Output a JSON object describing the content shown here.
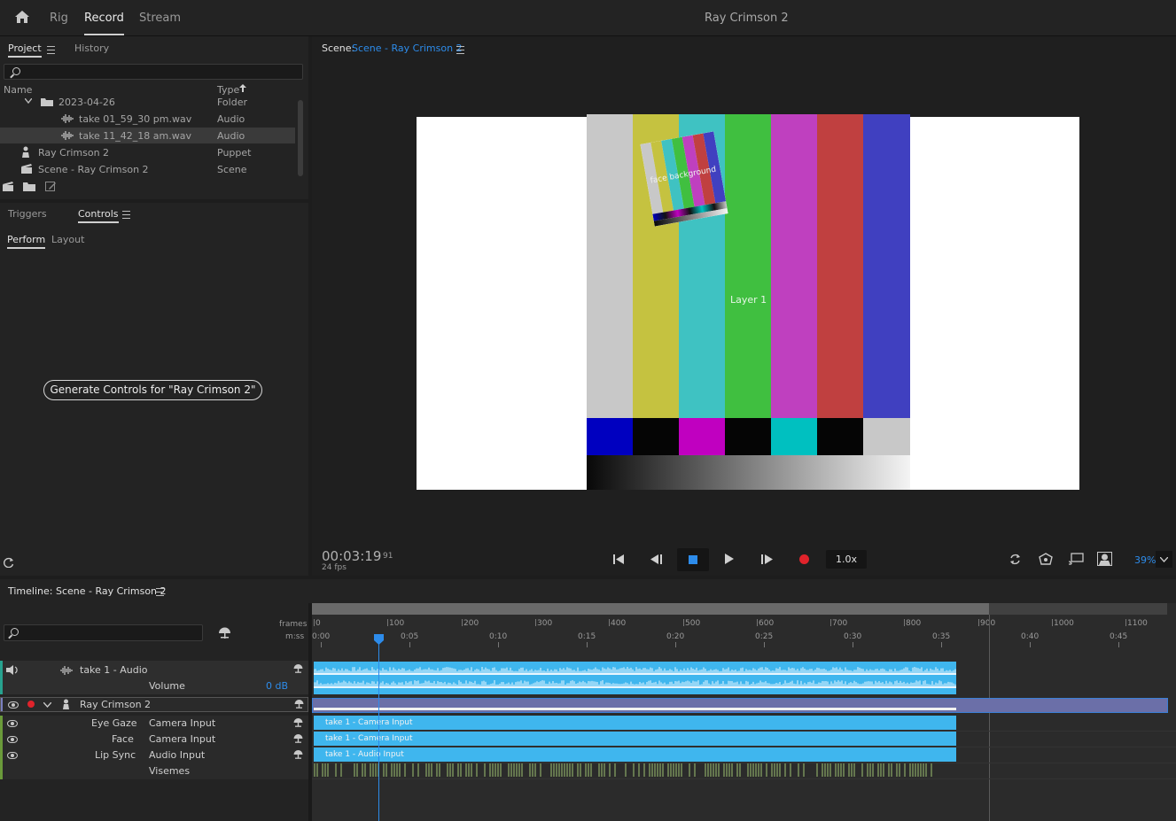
{
  "app": {
    "title": "Ray Crimson 2"
  },
  "workspace_tabs": [
    "Rig",
    "Record",
    "Stream"
  ],
  "project_panel": {
    "tabs": [
      "Project",
      "History"
    ],
    "columns": {
      "name": "Name",
      "type": "Type"
    },
    "items": [
      {
        "name": "2023-04-26",
        "type": "Folder"
      },
      {
        "name": "take 01_59_30 pm.wav",
        "type": "Audio"
      },
      {
        "name": "take 11_42_18 am.wav",
        "type": "Audio"
      },
      {
        "name": "Ray Crimson 2",
        "type": "Puppet"
      },
      {
        "name": "Scene - Ray Crimson 2",
        "type": "Scene"
      }
    ]
  },
  "controls_panel": {
    "tabs": [
      "Triggers",
      "Controls"
    ],
    "subtabs": [
      "Perform",
      "Layout"
    ],
    "generate_button": "Generate Controls for \"Ray Crimson 2\""
  },
  "scene_panel": {
    "label": "Scene:",
    "scene_name": "Scene - Ray Crimson 2",
    "layer_labels": [
      "face background",
      "Layer 1"
    ],
    "timecode": "00:03:19",
    "frame": "91",
    "fps": "24 fps",
    "speed": "1.0x",
    "zoom": "39%"
  },
  "timeline": {
    "title": "Timeline: Scene - Ray Crimson 2",
    "ruler_frames_label": "frames",
    "ruler_time_label": "m:ss",
    "frame_marks": [
      "0",
      "100",
      "200",
      "300",
      "400",
      "500",
      "600",
      "700",
      "800",
      "900",
      "1000",
      "1100"
    ],
    "time_marks": [
      "0:00",
      "0:05",
      "0:10",
      "0:15",
      "0:20",
      "0:25",
      "0:30",
      "0:35",
      "0:40",
      "0:45"
    ],
    "tracks": {
      "audio_track": "take 1 - Audio",
      "volume_label": "Volume",
      "volume_value": "0 dB",
      "puppet_track": "Ray Crimson 2",
      "behaviors": [
        {
          "name": "Eye Gaze",
          "input": "Camera Input",
          "clip": "take 1 - Camera Input"
        },
        {
          "name": "Face",
          "input": "Camera Input",
          "clip": "take 1 - Camera Input"
        },
        {
          "name": "Lip Sync",
          "input": "Audio Input",
          "clip": "take 1 - Audio Input"
        }
      ],
      "visemes_label": "Visemes"
    }
  },
  "colors": {
    "accent": "#3fb6ee",
    "link": "#2d8ceb",
    "record": "#e0232b"
  }
}
